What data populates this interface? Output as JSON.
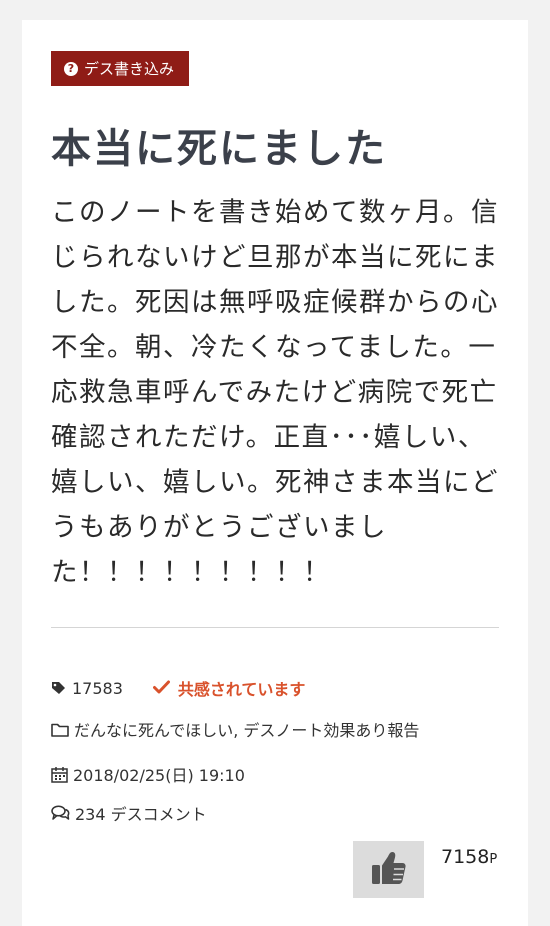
{
  "post": {
    "category_badge": "デス書き込み",
    "title": "本当に死にました",
    "body": "このノートを書き始めて数ヶ月。信じられないけど旦那が本当に死にました。死因は無呼吸症候群からの心不全。朝、冷たくなってました。一応救急車呼んでみたけど病院で死亡確認されただけ。正直･･･嬉しい、嬉しい、嬉しい。死神さま本当にどうもありがとうございました！！！！！！！！！"
  },
  "meta": {
    "count": "17583",
    "sympathy_label": "共感されています",
    "categories": "だんなに死んでほしい, デスノート効果あり報告",
    "date": "2018/02/25(日) 19:10",
    "comments": "234 デスコメント"
  },
  "like": {
    "points_value": "7158",
    "points_unit": "P"
  },
  "colors": {
    "badge_bg": "#8f1c16",
    "sympathy": "#d9522c",
    "title": "#3b404a",
    "like_bg": "#dcdcdc"
  },
  "icons": {
    "badge": "question-circle-icon",
    "count": "tag-icon",
    "sympathy": "check-icon",
    "categories": "folder-icon",
    "date": "calendar-icon",
    "comments": "comments-icon",
    "like": "thumbs-up-icon"
  }
}
